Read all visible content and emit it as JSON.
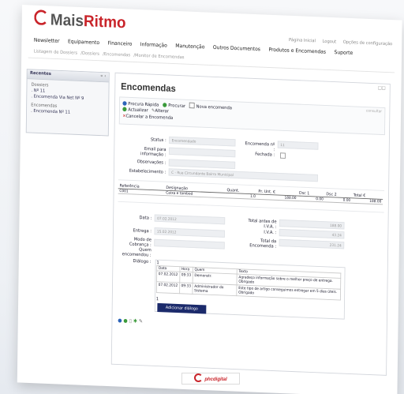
{
  "brand": {
    "part1": "Mais",
    "part2": "Ritmo"
  },
  "topright": [
    "Página Inicial",
    "Logout",
    "Opções de configuração"
  ],
  "nav": [
    "Newsletter",
    "Equipamento",
    "Financeiro",
    "Informação",
    "Manutenção",
    "Outros Documentos",
    "Produtos e Encomendas",
    "Suporte"
  ],
  "breadcrumb": [
    "Listagem de Dossiers",
    "/Dossiers",
    "/Encomendas",
    "/Monitor de Encomendas"
  ],
  "sidebar": {
    "title": "Recentes",
    "controls": "« ‹",
    "blocks": [
      {
        "head": "Dossiers",
        "lines": [
          ". Nº 11",
          ". Encomenda Via Net Nº 9"
        ]
      },
      {
        "head": "Encomendas",
        "lines": [
          ". Encomenda Nº 11"
        ]
      }
    ]
  },
  "page": {
    "title": "Encomendas",
    "corner": "□□"
  },
  "toolbar": {
    "quick_search": "Procura Rápida",
    "search": "Procurar",
    "new_order": "Nova encomenda",
    "update": "Actualizar",
    "edit": "Alterar",
    "cancel": "Cancelar a Encomenda",
    "hint": "consultar"
  },
  "form": {
    "status_label": "Status :",
    "status_value": "Encomendado",
    "email_label": "Email para informação :",
    "obs_label": "Observações :",
    "estab_label": "Estabelecimento :",
    "estab_value": "C - Rua Circundante Bairro Municipal",
    "order_no_label": "Encomenda nº :",
    "order_no_value": "11",
    "closed_label": "Fechada :"
  },
  "items": {
    "headers": [
      "Referência",
      "Designação",
      "Quant.",
      "Pr. Unt. €",
      "Dsc 1",
      "Dsc 2",
      "Total €"
    ],
    "rows": [
      [
        "C001",
        "Caixa e tambod",
        "1.0",
        "188.00",
        "0.00",
        "0.00",
        "188.00"
      ]
    ]
  },
  "summary": {
    "data_label": "Data :",
    "data_value": "07.02.2012",
    "entrega_label": "Entrega :",
    "entrega_value": "15.02.2012",
    "modo_label": "Modo de Cobrança :",
    "quem_label": "Quem encomendou :",
    "dialogo_label": "Diálogo :",
    "total_before_label": "Total antes de I.V.A. :",
    "total_before_value": "188.00",
    "iva_label": "I.V.A. :",
    "iva_value": "43.24",
    "total_label": "Total da Encomenda :",
    "total_value": "231.24"
  },
  "dialog": {
    "count": "1",
    "headers": [
      "Data",
      "Hora",
      "Quem",
      "Texto"
    ],
    "rows": [
      [
        "07.02.2012",
        "09:33",
        "Demonstr.",
        "Agradeço informação sobre o melhor preço de entrega. Obrigado"
      ],
      [
        "07.02.2012",
        "09:33",
        "Administrador do Sistema",
        "Este tipo de artigo conseguimos entregar em 5 dias úteis. Obrigado"
      ]
    ],
    "footer_count": "1",
    "add_button": "Adicionar diálogo"
  },
  "footer_logo": "phcdigital",
  "icon_colors": {
    "blue": "#2b63b8",
    "green": "#3a9a3a",
    "red": "#c9242a"
  }
}
